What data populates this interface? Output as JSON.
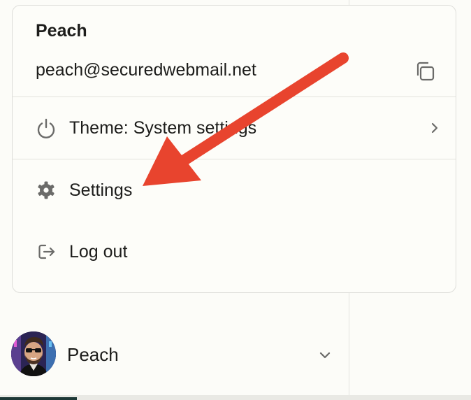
{
  "menu": {
    "user_name": "Peach",
    "user_email": "peach@securedwebmail.net",
    "items": [
      {
        "label": "Theme: System settings",
        "icon": "power-icon"
      },
      {
        "label": "Settings",
        "icon": "gear-icon"
      },
      {
        "label": "Log out",
        "icon": "log-out-icon"
      }
    ]
  },
  "account": {
    "name": "Peach"
  },
  "colors": {
    "background": "#fcfcf8",
    "border": "#dededa",
    "text": "#1d1d1b",
    "icon": "#6b6b69",
    "annotation_arrow": "#e8442e"
  }
}
